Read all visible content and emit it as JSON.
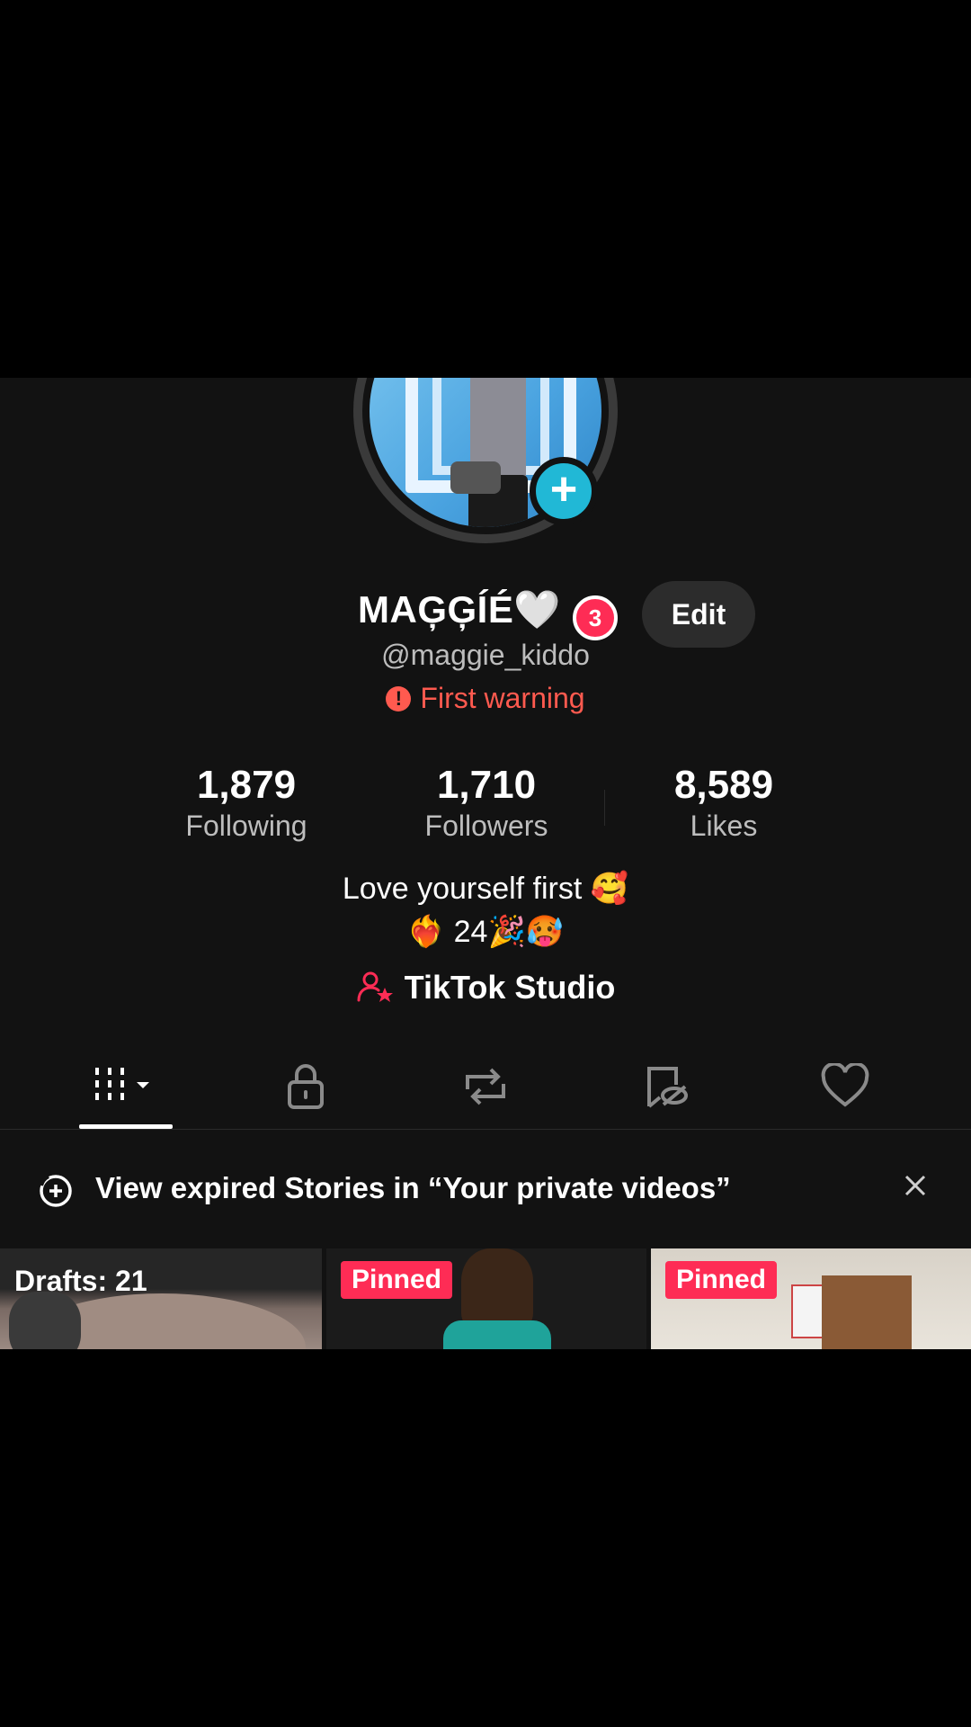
{
  "profile": {
    "display_name": "MAĢĢÍÉ🤍",
    "notification_count": "3",
    "edit_label": "Edit",
    "username": "@maggie_kiddo",
    "warning_text": "First warning"
  },
  "stats": {
    "following": {
      "value": "1,879",
      "label": "Following"
    },
    "followers": {
      "value": "1,710",
      "label": "Followers"
    },
    "likes": {
      "value": "8,589",
      "label": "Likes"
    }
  },
  "bio": {
    "line1": "Love yourself first 🥰",
    "line2": "❤️‍🔥 24🎉🥵"
  },
  "studio": {
    "label": "TikTok Studio"
  },
  "tabs": [
    {
      "name": "videos",
      "icon": "grid-icon",
      "active": true
    },
    {
      "name": "private",
      "icon": "lock-icon"
    },
    {
      "name": "reposts",
      "icon": "repost-icon"
    },
    {
      "name": "favorites",
      "icon": "bookmark-hidden-icon"
    },
    {
      "name": "liked",
      "icon": "heart-icon"
    }
  ],
  "banner": {
    "text": "View expired Stories in “Your private videos”"
  },
  "grid": {
    "drafts_label": "Drafts: 21",
    "pinned_label": "Pinned"
  },
  "colors": {
    "background": "#121212",
    "accent": "#fe2c55",
    "add_badge": "#21b8d6",
    "warning": "#ff5a4f"
  }
}
